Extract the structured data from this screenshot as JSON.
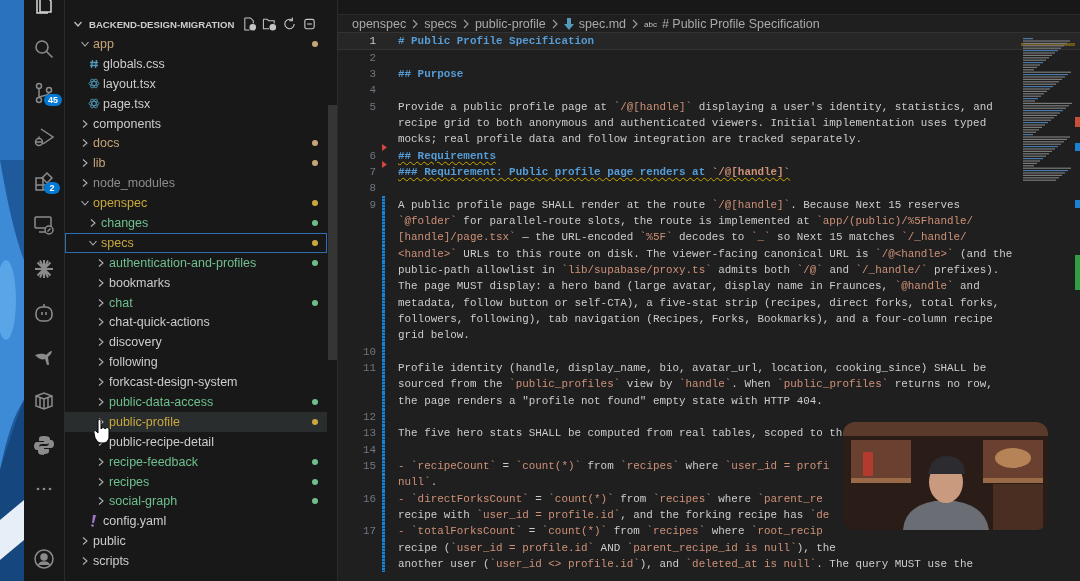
{
  "activity_bar": [
    {
      "kind": "explorer",
      "selected": true
    },
    {
      "kind": "search",
      "selected": false
    },
    {
      "kind": "source-control",
      "selected": false,
      "badge": "45"
    },
    {
      "kind": "run-debug",
      "selected": false
    },
    {
      "kind": "extensions",
      "selected": false,
      "badge": "2"
    },
    {
      "kind": "remote",
      "selected": false
    },
    {
      "kind": "sparkle",
      "selected": false
    },
    {
      "kind": "robot",
      "selected": false
    },
    {
      "kind": "kangaroo",
      "selected": false
    },
    {
      "kind": "container",
      "selected": false
    },
    {
      "kind": "python",
      "selected": false
    },
    {
      "kind": "more",
      "selected": false
    },
    {
      "kind": "account",
      "selected": false
    }
  ],
  "explorer": {
    "title": "BACKEND-DESIGN-MIGRATION",
    "expanded": true,
    "tree": [
      {
        "name": "app",
        "kind": "folder",
        "expanded": true,
        "selected": false,
        "hovered": false,
        "color": "#c6a57a",
        "dot": true,
        "children": [
          {
            "name": "globals.css",
            "kind": "css",
            "selected": false,
            "hovered": false
          },
          {
            "name": "layout.tsx",
            "kind": "react",
            "selected": false,
            "hovered": false
          },
          {
            "name": "page.tsx",
            "kind": "react",
            "selected": false,
            "hovered": false
          }
        ]
      },
      {
        "name": "components",
        "kind": "folder",
        "expanded": false,
        "selected": false,
        "hovered": false
      },
      {
        "name": "docs",
        "kind": "folder",
        "expanded": false,
        "selected": false,
        "hovered": false,
        "color": "#c6a57a",
        "dot": true
      },
      {
        "name": "lib",
        "kind": "folder",
        "expanded": false,
        "selected": false,
        "hovered": false,
        "color": "#c6a57a",
        "dot": true
      },
      {
        "name": "node_modules",
        "kind": "folder",
        "expanded": false,
        "selected": false,
        "hovered": false,
        "color": "#8c8c8c",
        "dot": false
      },
      {
        "name": "openspec",
        "kind": "folder",
        "expanded": true,
        "selected": false,
        "hovered": false,
        "color": "#c9a83e",
        "dot": true,
        "children": [
          {
            "name": "changes",
            "kind": "folder",
            "expanded": false,
            "selected": false,
            "hovered": false,
            "color": "#6fbf8e",
            "dot": true
          },
          {
            "name": "specs",
            "kind": "folder",
            "expanded": true,
            "selected": true,
            "hovered": false,
            "color": "#c9a83e",
            "dot": true,
            "children": [
              {
                "name": "authentication-and-profiles",
                "kind": "folder",
                "expanded": false,
                "selected": false,
                "hovered": false,
                "color": "#6fbf8e",
                "dot": true
              },
              {
                "name": "bookmarks",
                "kind": "folder",
                "expanded": false,
                "selected": false,
                "hovered": false
              },
              {
                "name": "chat",
                "kind": "folder",
                "expanded": false,
                "selected": false,
                "hovered": false,
                "color": "#6fbf8e",
                "dot": true
              },
              {
                "name": "chat-quick-actions",
                "kind": "folder",
                "expanded": false,
                "selected": false,
                "hovered": false
              },
              {
                "name": "discovery",
                "kind": "folder",
                "expanded": false,
                "selected": false,
                "hovered": false
              },
              {
                "name": "following",
                "kind": "folder",
                "expanded": false,
                "selected": false,
                "hovered": false
              },
              {
                "name": "forkcast-design-system",
                "kind": "folder",
                "expanded": false,
                "selected": false,
                "hovered": false
              },
              {
                "name": "public-data-access",
                "kind": "folder",
                "expanded": false,
                "selected": false,
                "hovered": false,
                "color": "#6fbf8e",
                "dot": true
              },
              {
                "name": "public-profile",
                "kind": "folder",
                "expanded": false,
                "selected": false,
                "hovered": true,
                "color": "#c9a83e",
                "dot": true
              },
              {
                "name": "public-recipe-detail",
                "kind": "folder",
                "expanded": false,
                "selected": false,
                "hovered": false
              },
              {
                "name": "recipe-feedback",
                "kind": "folder",
                "expanded": false,
                "selected": false,
                "hovered": false,
                "color": "#6fbf8e",
                "dot": true
              },
              {
                "name": "recipes",
                "kind": "folder",
                "expanded": false,
                "selected": false,
                "hovered": false,
                "color": "#6fbf8e",
                "dot": true
              },
              {
                "name": "social-graph",
                "kind": "folder",
                "expanded": false,
                "selected": false,
                "hovered": false,
                "color": "#6fbf8e",
                "dot": true
              }
            ]
          },
          {
            "name": "config.yaml",
            "kind": "yaml",
            "selected": false,
            "hovered": false
          }
        ]
      },
      {
        "name": "public",
        "kind": "folder",
        "expanded": false,
        "selected": false,
        "hovered": false
      },
      {
        "name": "scripts",
        "kind": "folder",
        "expanded": false,
        "selected": false,
        "hovered": false
      }
    ]
  },
  "breadcrumb": {
    "items": [
      "openspec",
      "specs",
      "public-profile"
    ],
    "file": "spec.md",
    "symbol_icon": "abc",
    "symbol": "# Public Profile Specification"
  },
  "editor": {
    "lines": [
      {
        "number": "1",
        "current": true,
        "modified": false,
        "removed": false,
        "parts": [
          {
            "kind": "heading",
            "text": "# Public Profile Specification"
          }
        ]
      },
      {
        "number": "2",
        "current": false,
        "modified": false,
        "removed": false
      },
      {
        "number": "3",
        "current": false,
        "modified": false,
        "removed": false,
        "parts": [
          {
            "kind": "heading",
            "text": "## Purpose"
          }
        ]
      },
      {
        "number": "4",
        "current": false,
        "modified": false,
        "removed": false
      },
      {
        "number": "5",
        "current": false,
        "modified": false,
        "removed": false,
        "parts": [
          {
            "kind": "plain",
            "text": "Provide a public profile page at "
          },
          {
            "kind": "code",
            "text": "`/@[handle]`"
          },
          {
            "kind": "plain",
            "text": " displaying a user's identity, statistics, and"
          }
        ]
      },
      {
        "modified": false,
        "removed": false,
        "parts": [
          {
            "kind": "plain",
            "text": "recipe grid to both anonymous and authenticated viewers. Initial implementation uses typed"
          }
        ]
      },
      {
        "modified": false,
        "removed": false,
        "parts": [
          {
            "kind": "plain",
            "text": "mocks; real profile data and follow integration are tracked separately."
          }
        ]
      },
      {
        "number": "6",
        "current": false,
        "modified": false,
        "removed": true,
        "squiggle": true,
        "parts": [
          {
            "kind": "heading",
            "text": "## Requirements"
          }
        ]
      },
      {
        "number": "7",
        "current": false,
        "modified": false,
        "removed": true,
        "squiggle": true,
        "parts": [
          {
            "kind": "heading",
            "text": "### Requirement: Public profile page renders at "
          },
          {
            "kind": "heading-code",
            "text": "`/@[handle]`"
          }
        ]
      },
      {
        "number": "8",
        "current": false,
        "modified": false,
        "removed": false
      },
      {
        "number": "9",
        "current": false,
        "modified": true,
        "removed": false,
        "parts": [
          {
            "kind": "plain",
            "text": "A public profile page SHALL render at the route "
          },
          {
            "kind": "code",
            "text": "`/@[handle]`"
          },
          {
            "kind": "plain",
            "text": ". Because Next 15 reserves"
          }
        ]
      },
      {
        "modified": true,
        "removed": false,
        "parts": [
          {
            "kind": "code",
            "text": "`@folder`"
          },
          {
            "kind": "plain",
            "text": " for parallel-route slots, the route is implemented at "
          },
          {
            "kind": "code",
            "text": "`app/(public)/%5Fhandle/"
          }
        ]
      },
      {
        "modified": true,
        "removed": false,
        "parts": [
          {
            "kind": "code",
            "text": "[handle]/page.tsx`"
          },
          {
            "kind": "plain",
            "text": " — the URL-encoded "
          },
          {
            "kind": "code",
            "text": "`%5F`"
          },
          {
            "kind": "plain",
            "text": " decodes to "
          },
          {
            "kind": "code",
            "text": "`_`"
          },
          {
            "kind": "plain",
            "text": " so Next 15 matches "
          },
          {
            "kind": "code",
            "text": "`/_handle/"
          }
        ]
      },
      {
        "modified": true,
        "removed": false,
        "parts": [
          {
            "kind": "code",
            "text": "<handle>`"
          },
          {
            "kind": "plain",
            "text": " URLs to this route on disk. The viewer-facing canonical URL is "
          },
          {
            "kind": "code",
            "text": "`/@<handle>`"
          },
          {
            "kind": "plain",
            "text": " (and the"
          }
        ]
      },
      {
        "modified": true,
        "removed": false,
        "parts": [
          {
            "kind": "plain",
            "text": "public-path allowlist in "
          },
          {
            "kind": "code",
            "text": "`lib/supabase/proxy.ts`"
          },
          {
            "kind": "plain",
            "text": " admits both "
          },
          {
            "kind": "code",
            "text": "`/@`"
          },
          {
            "kind": "plain",
            "text": " and "
          },
          {
            "kind": "code",
            "text": "`/_handle/`"
          },
          {
            "kind": "plain",
            "text": " prefixes)."
          }
        ]
      },
      {
        "modified": true,
        "removed": false,
        "parts": [
          {
            "kind": "plain",
            "text": "The page MUST display: a hero band (large avatar, display name in Fraunces, "
          },
          {
            "kind": "code",
            "text": "`@handle`"
          },
          {
            "kind": "plain",
            "text": " and"
          }
        ]
      },
      {
        "modified": true,
        "removed": false,
        "parts": [
          {
            "kind": "plain",
            "text": "metadata, follow button or self-CTA), a five-stat strip (recipes, direct forks, total forks,"
          }
        ]
      },
      {
        "modified": true,
        "removed": false,
        "parts": [
          {
            "kind": "plain",
            "text": "followers, following), tab navigation (Recipes, Forks, Bookmarks), and a four-column recipe"
          }
        ]
      },
      {
        "modified": true,
        "removed": false,
        "parts": [
          {
            "kind": "plain",
            "text": "grid below."
          }
        ]
      },
      {
        "number": "10",
        "current": false,
        "modified": true,
        "removed": false
      },
      {
        "number": "11",
        "current": false,
        "modified": true,
        "removed": false,
        "parts": [
          {
            "kind": "plain",
            "text": "Profile identity (handle, display_name, bio, avatar_url, location, cooking_since) SHALL be"
          }
        ]
      },
      {
        "modified": true,
        "removed": false,
        "parts": [
          {
            "kind": "plain",
            "text": "sourced from the "
          },
          {
            "kind": "code",
            "text": "`public_profiles`"
          },
          {
            "kind": "plain",
            "text": " view by "
          },
          {
            "kind": "code",
            "text": "`handle`"
          },
          {
            "kind": "plain",
            "text": ". When "
          },
          {
            "kind": "code",
            "text": "`public_profiles`"
          },
          {
            "kind": "plain",
            "text": " returns no row,"
          }
        ]
      },
      {
        "modified": true,
        "removed": false,
        "parts": [
          {
            "kind": "plain",
            "text": "the page renders a \"profile not found\" empty state with HTTP 404."
          }
        ]
      },
      {
        "number": "12",
        "current": false,
        "modified": true,
        "removed": false
      },
      {
        "number": "13",
        "current": false,
        "modified": true,
        "removed": false,
        "parts": [
          {
            "kind": "plain",
            "text": "The five hero stats SHALL be computed from real tables, scoped to th"
          }
        ]
      },
      {
        "number": "14",
        "current": false,
        "modified": true,
        "removed": false
      },
      {
        "number": "15",
        "current": false,
        "modified": true,
        "removed": false,
        "parts": [
          {
            "kind": "bullet",
            "text": "- "
          },
          {
            "kind": "code",
            "text": "`recipeCount`"
          },
          {
            "kind": "plain",
            "text": " = "
          },
          {
            "kind": "code",
            "text": "`count(*)`"
          },
          {
            "kind": "plain",
            "text": " from "
          },
          {
            "kind": "code",
            "text": "`recipes`"
          },
          {
            "kind": "plain",
            "text": " where "
          },
          {
            "kind": "code",
            "text": "`user_id = profi"
          }
        ]
      },
      {
        "modified": true,
        "removed": false,
        "parts": [
          {
            "kind": "code",
            "text": "null`"
          },
          {
            "kind": "plain",
            "text": "."
          }
        ]
      },
      {
        "number": "16",
        "current": false,
        "modified": true,
        "removed": false,
        "parts": [
          {
            "kind": "bullet",
            "text": "- "
          },
          {
            "kind": "code",
            "text": "`directForksCount`"
          },
          {
            "kind": "plain",
            "text": " = "
          },
          {
            "kind": "code",
            "text": "`count(*)`"
          },
          {
            "kind": "plain",
            "text": " from "
          },
          {
            "kind": "code",
            "text": "`recipes`"
          },
          {
            "kind": "plain",
            "text": " where "
          },
          {
            "kind": "code",
            "text": "`parent_re"
          }
        ]
      },
      {
        "modified": true,
        "removed": false,
        "parts": [
          {
            "kind": "plain",
            "text": "recipe with "
          },
          {
            "kind": "code",
            "text": "`user_id = profile.id`"
          },
          {
            "kind": "plain",
            "text": ", and the forking recipe has "
          },
          {
            "kind": "code",
            "text": "`de"
          }
        ]
      },
      {
        "number": "17",
        "current": false,
        "modified": true,
        "removed": false,
        "parts": [
          {
            "kind": "bullet",
            "text": "- "
          },
          {
            "kind": "code",
            "text": "`totalForksCount`"
          },
          {
            "kind": "plain",
            "text": " = "
          },
          {
            "kind": "code",
            "text": "`count(*)`"
          },
          {
            "kind": "plain",
            "text": " from "
          },
          {
            "kind": "code",
            "text": "`recipes`"
          },
          {
            "kind": "plain",
            "text": " where "
          },
          {
            "kind": "code",
            "text": "`root_recip"
          }
        ]
      },
      {
        "modified": true,
        "removed": false,
        "parts": [
          {
            "kind": "plain",
            "text": "recipe ("
          },
          {
            "kind": "code",
            "text": "`user_id = profile.id`"
          },
          {
            "kind": "plain",
            "text": " AND "
          },
          {
            "kind": "code",
            "text": "`parent_recipe_id is null`"
          },
          {
            "kind": "plain",
            "text": "), the"
          }
        ]
      },
      {
        "modified": true,
        "removed": false,
        "parts": [
          {
            "kind": "plain",
            "text": "another user ("
          },
          {
            "kind": "code",
            "text": "`user_id <> profile.id`"
          },
          {
            "kind": "plain",
            "text": "), and "
          },
          {
            "kind": "code",
            "text": "`deleted_at is null`"
          },
          {
            "kind": "plain",
            "text": ". The query MUST use the"
          }
        ]
      }
    ]
  }
}
